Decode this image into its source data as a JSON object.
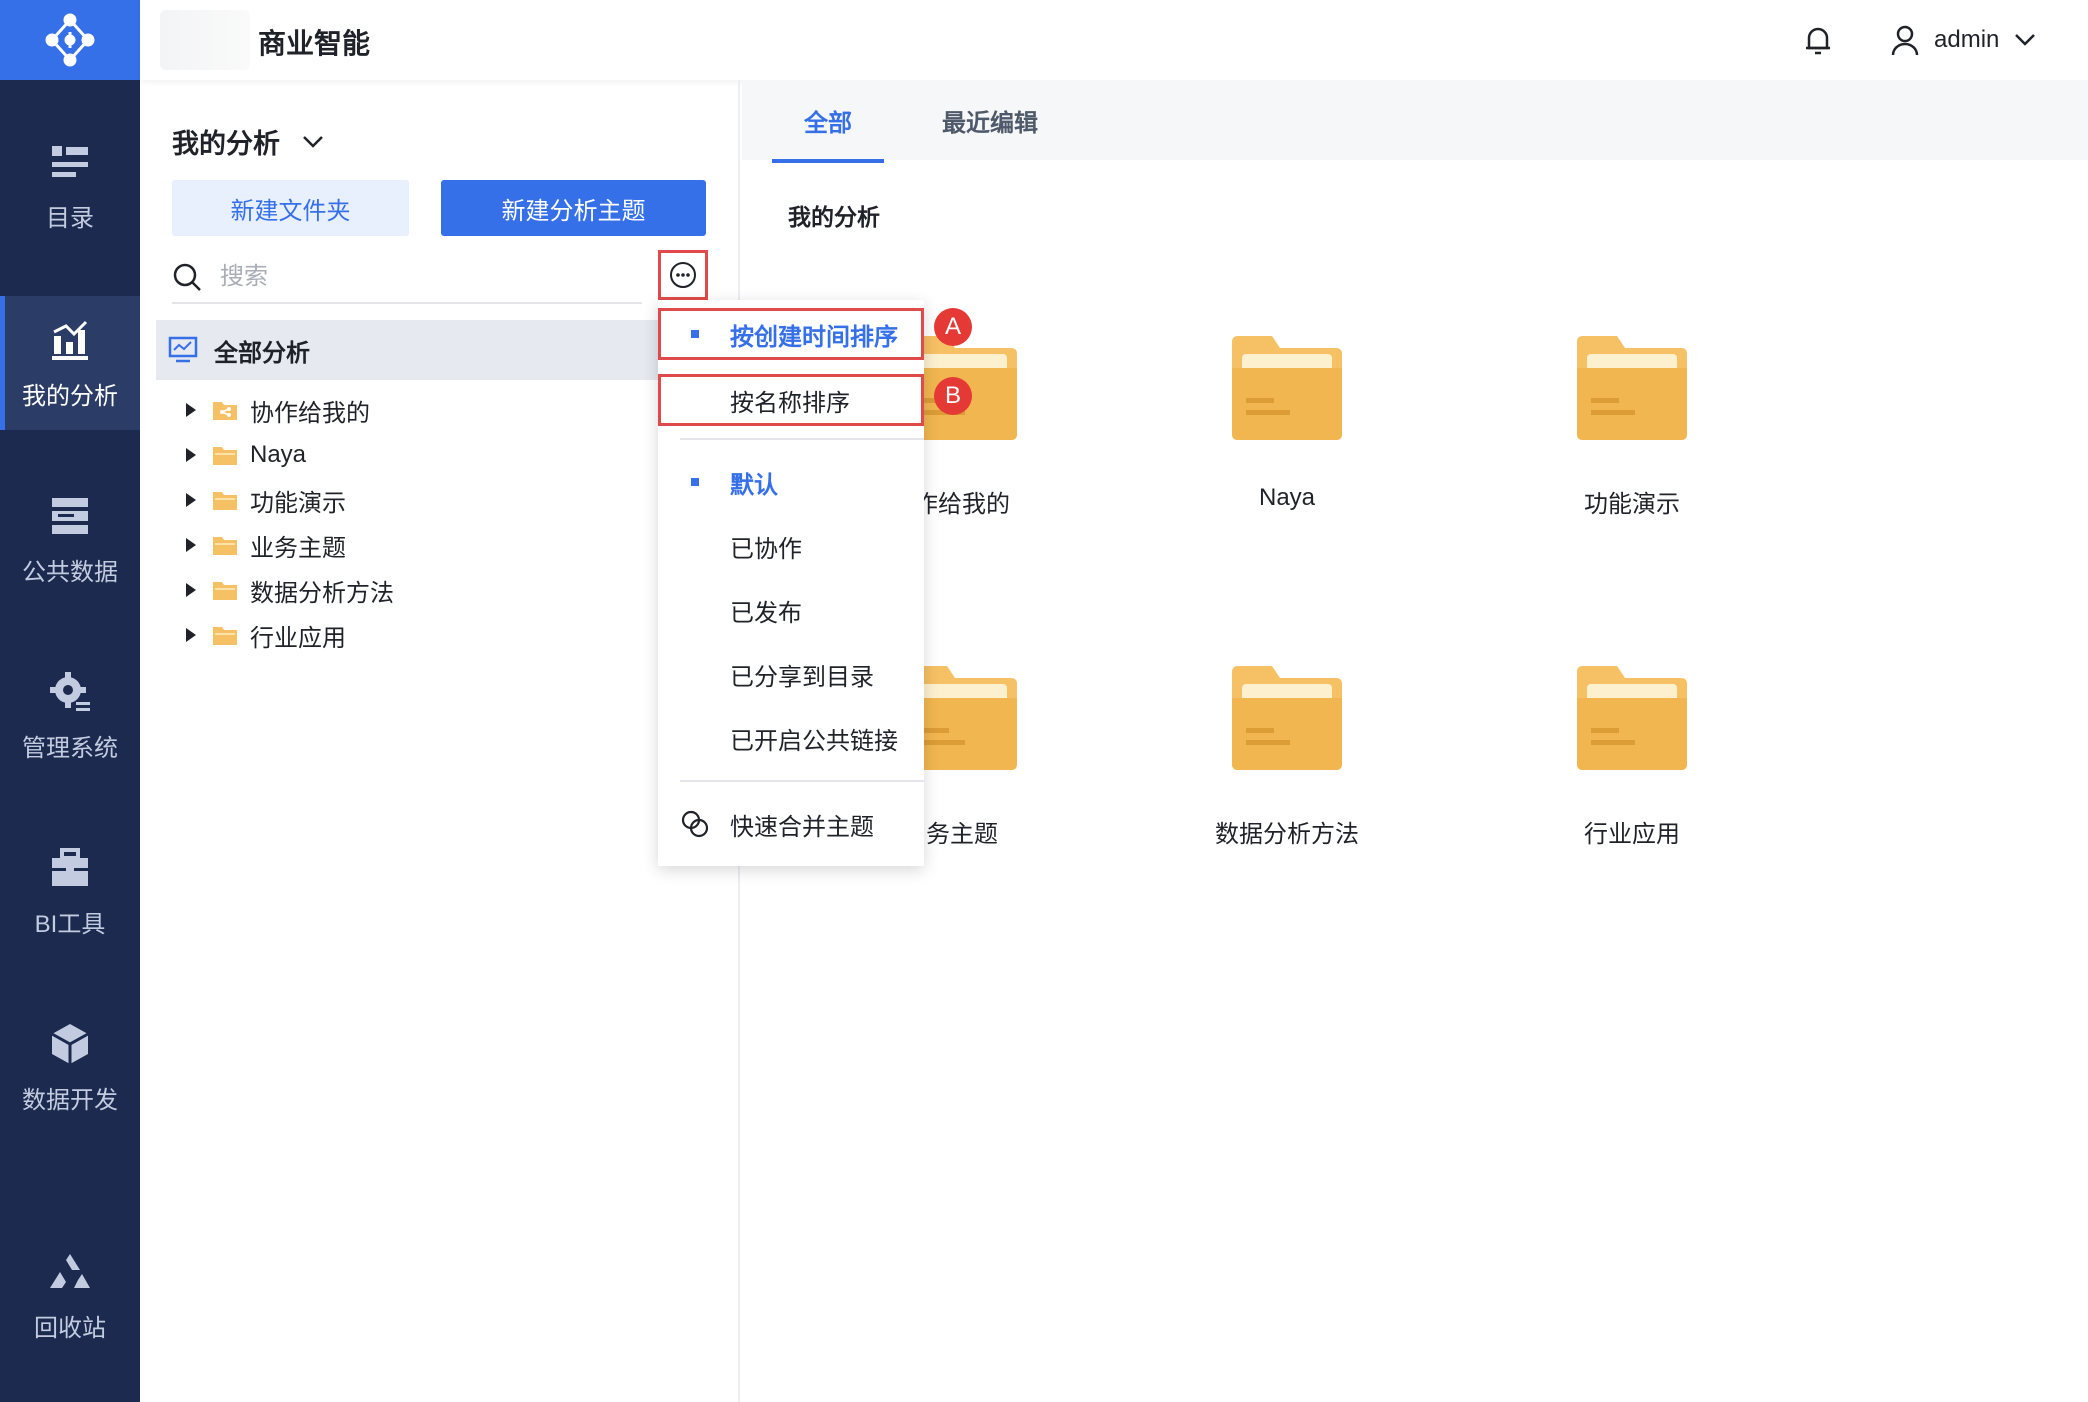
{
  "app": {
    "title": "商业智能"
  },
  "header": {
    "user_name": "admin"
  },
  "nav": {
    "items": [
      {
        "label": "目录"
      },
      {
        "label": "我的分析"
      },
      {
        "label": "公共数据"
      },
      {
        "label": "管理系统"
      },
      {
        "label": "BI工具"
      },
      {
        "label": "数据开发"
      },
      {
        "label": "回收站"
      }
    ]
  },
  "panel": {
    "title": "我的分析",
    "new_folder_label": "新建文件夹",
    "new_topic_label": "新建分析主题",
    "search_placeholder": "搜索",
    "tree": {
      "root_label": "全部分析",
      "items": [
        {
          "label": "协作给我的"
        },
        {
          "label": "Naya"
        },
        {
          "label": "功能演示"
        },
        {
          "label": "业务主题"
        },
        {
          "label": "数据分析方法"
        },
        {
          "label": "行业应用"
        }
      ]
    }
  },
  "main": {
    "tabs": [
      {
        "label": "全部"
      },
      {
        "label": "最近编辑"
      }
    ],
    "breadcrumb": "我的分析",
    "folders": [
      {
        "label": "作给我的"
      },
      {
        "label": "Naya"
      },
      {
        "label": "功能演示"
      },
      {
        "label": "务主题"
      },
      {
        "label": "数据分析方法"
      },
      {
        "label": "行业应用"
      }
    ]
  },
  "menu": {
    "sort_by_created": "按创建时间排序",
    "sort_by_name": "按名称排序",
    "filter_default": "默认",
    "filter_collaborated": "已协作",
    "filter_published": "已发布",
    "filter_shared_to_catalog": "已分享到目录",
    "filter_public_link": "已开启公共链接",
    "quick_merge": "快速合并主题"
  },
  "annotations": {
    "marker_a": "A",
    "marker_b": "B"
  },
  "colors": {
    "accent": "#3670e8",
    "rail": "#1b2a4e",
    "highlight": "#e04a4a",
    "folder": "#f2b650"
  }
}
